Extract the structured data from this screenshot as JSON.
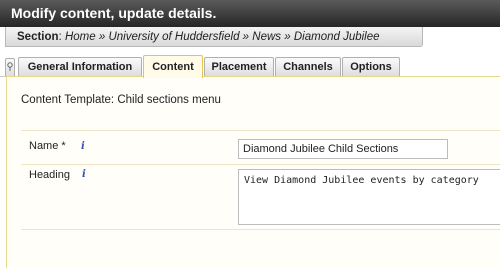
{
  "header": {
    "title": "Modify content, update details."
  },
  "breadcrumb": {
    "label": "Section",
    "items": [
      "Home",
      "University of Huddersfield",
      "News",
      "Diamond Jubilee"
    ],
    "separator": "»"
  },
  "tabs": [
    {
      "label": "General Information",
      "active": false
    },
    {
      "label": "Content",
      "active": true
    },
    {
      "label": "Placement",
      "active": false
    },
    {
      "label": "Channels",
      "active": false
    },
    {
      "label": "Options",
      "active": false
    }
  ],
  "panel": {
    "template_prefix": "Content Template:",
    "template_name": "Child sections menu",
    "fields": {
      "name": {
        "label": "Name *",
        "value": "Diamond Jubilee Child Sections"
      },
      "heading": {
        "label": "Heading",
        "value": "View Diamond Jubilee events by category"
      }
    },
    "info_glyph": "i"
  },
  "colors": {
    "title_bar": "#262626",
    "active_tab": "#fffbe8",
    "active_tab_border": "#e6c64a",
    "info_icon": "#3355aa"
  }
}
